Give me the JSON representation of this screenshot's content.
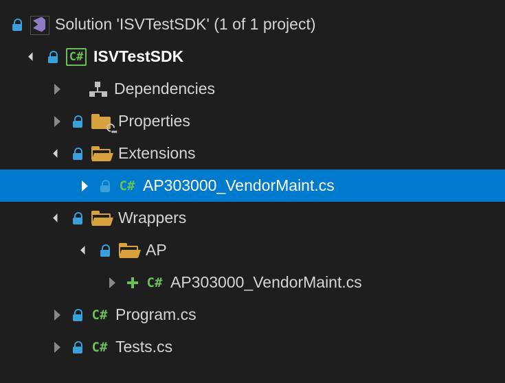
{
  "solution": {
    "title": "Solution 'ISVTestSDK' (1 of 1 project)"
  },
  "project": {
    "name": "ISVTestSDK",
    "nodes": {
      "dependencies": "Dependencies",
      "properties": "Properties",
      "extensions": {
        "label": "Extensions",
        "file1": "AP303000_VendorMaint.cs"
      },
      "wrappers": {
        "label": "Wrappers",
        "ap": {
          "label": "AP",
          "file1": "AP303000_VendorMaint.cs"
        }
      },
      "program": "Program.cs",
      "tests": "Tests.cs"
    }
  }
}
